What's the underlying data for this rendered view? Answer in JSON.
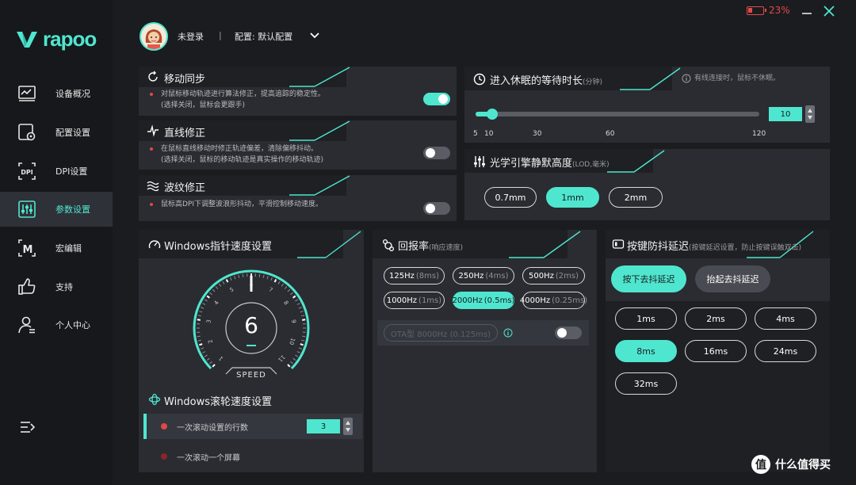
{
  "brand": {
    "name": "rapoo"
  },
  "colors": {
    "accent": "#4fe6cf",
    "background": "#1b1c20",
    "panel": "#2a2c31",
    "sidebar": "#17181b",
    "battery": "#e24a4a",
    "bullet": "#e04848"
  },
  "window": {
    "battery_percent": "23%",
    "battery_level": 0.23
  },
  "header": {
    "login_status": "未登录",
    "separator": "|",
    "profile_label": "配置: 默认配置"
  },
  "sidebar": {
    "items": [
      {
        "label": "设备概况",
        "icon": "monitor-chart-icon",
        "active": false
      },
      {
        "label": "配置设置",
        "icon": "config-settings-icon",
        "active": false
      },
      {
        "label": "DPI设置",
        "icon": "dpi-icon",
        "active": false
      },
      {
        "label": "参数设置",
        "icon": "sliders-icon",
        "active": true
      },
      {
        "label": "宏编辑",
        "icon": "macro-m-icon",
        "active": false
      },
      {
        "label": "支持",
        "icon": "thumbs-up-icon",
        "active": false
      },
      {
        "label": "个人中心",
        "icon": "user-icon",
        "active": false
      }
    ]
  },
  "motion_sync": {
    "title": "移动同步",
    "desc1": "对鼠标移动轨迹进行算法修正，提高追踪的稳定性。",
    "desc2": "(选择关闭，鼠标会更跟手)",
    "enabled": true
  },
  "line_correction": {
    "title": "直线修正",
    "desc1": "在鼠标直线移动时修正轨迹偏差，清除偏移抖动。",
    "desc2": "(选择关闭，鼠标的移动轨迹是真实操作的移动轨迹)",
    "enabled": false
  },
  "ripple_control": {
    "title": "波纹修正",
    "desc1": "鼠标高DPI下调整波浪形抖动，平滑控制移动速度。",
    "enabled": false
  },
  "sleep": {
    "title": "进入休眠的等待时长",
    "unit": "(分钟)",
    "note": "有线连接时，鼠标不休眠。",
    "value": "10",
    "min": 5,
    "max": 120,
    "current": 10,
    "ticks": [
      "5",
      "10",
      "30",
      "60",
      "120"
    ]
  },
  "lod": {
    "title": "光学引擎静默高度",
    "unit": "(LOD,毫米)",
    "options": [
      "0.7mm",
      "1mm",
      "2mm"
    ],
    "selected": 1
  },
  "pointer_speed": {
    "title": "Windows指针速度设置",
    "value": "6",
    "caption": "SPEED",
    "ticks": [
      "1",
      "2",
      "3",
      "4",
      "5",
      "6",
      "7",
      "8",
      "9",
      "10",
      "11"
    ],
    "min": 1,
    "max": 11,
    "current": 6
  },
  "wheel": {
    "title": "Windows滚轮速度设置",
    "rows": [
      {
        "label": "一次滚动设置的行数",
        "value": "3",
        "selected": true
      },
      {
        "label": "一次滚动一个屏幕",
        "selected": false
      }
    ]
  },
  "polling": {
    "title": "回报率",
    "sub": "(响应速度)",
    "options": [
      {
        "rate": "125Hz",
        "ms": "(8ms)"
      },
      {
        "rate": "250Hz",
        "ms": "(4ms)"
      },
      {
        "rate": "500Hz",
        "ms": "(2ms)"
      },
      {
        "rate": "1000Hz",
        "ms": "(1ms)"
      },
      {
        "rate": "2000Hz",
        "ms": "(0.5ms)"
      },
      {
        "rate": "4000Hz",
        "ms": "(0.25ms)"
      }
    ],
    "selected": 4,
    "ota": {
      "label": "OTA型 8000Hz (0.125ms)",
      "enabled": false
    }
  },
  "debounce": {
    "title": "按键防抖延迟",
    "sub": "(按键延迟设置，防止按键误触双击)",
    "tabs": [
      "按下去抖延迟",
      "抬起去抖延迟"
    ],
    "active_tab": 0,
    "options": [
      "1ms",
      "2ms",
      "4ms",
      "8ms",
      "16ms",
      "24ms",
      "32ms"
    ],
    "selected": 3
  },
  "watermark": {
    "badge": "值",
    "text": "什么值得买"
  }
}
